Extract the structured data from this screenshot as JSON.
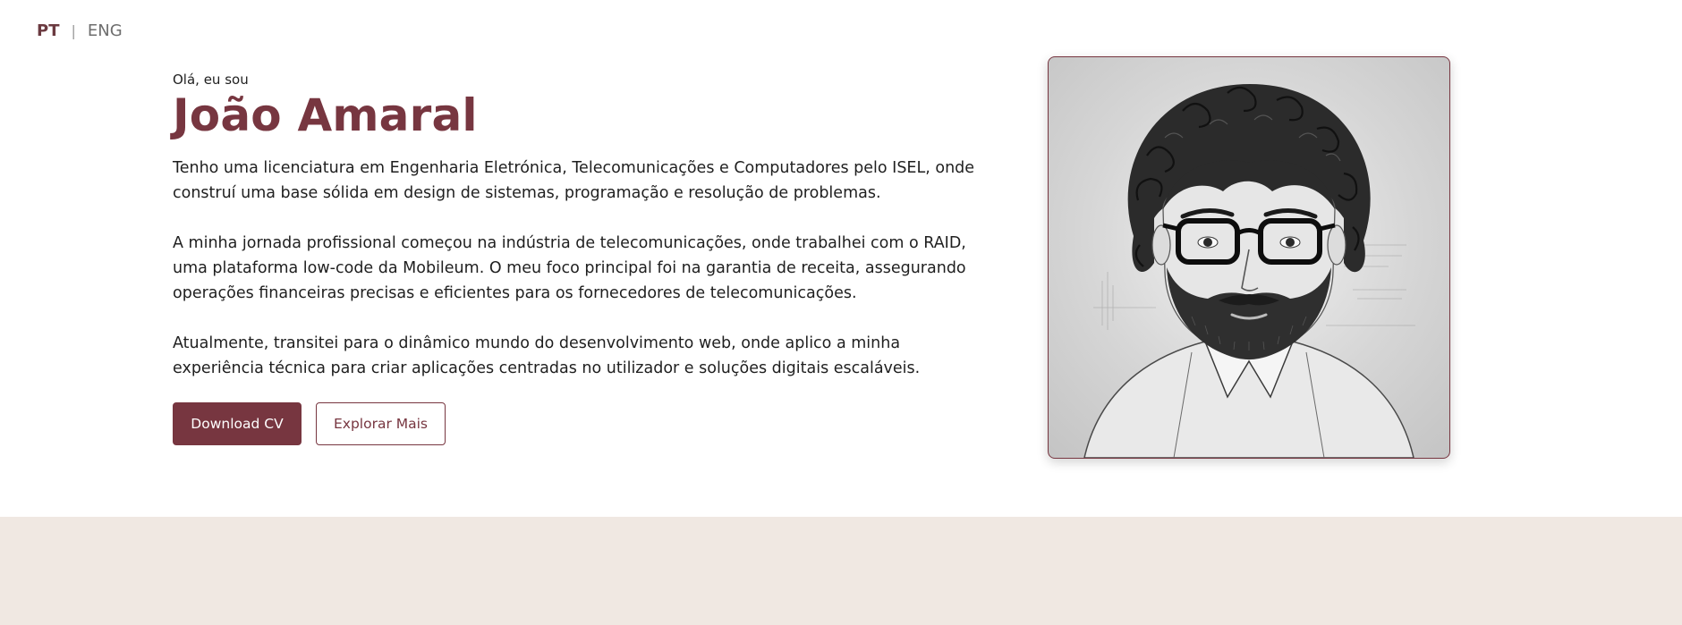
{
  "language": {
    "active": "PT",
    "separator": "|",
    "other": "ENG"
  },
  "hero": {
    "greeting": "Olá, eu sou",
    "name": "João Amaral",
    "paragraphs": [
      "Tenho uma licenciatura em Engenharia Eletrónica, Telecomunicações e Computadores pelo ISEL, onde construí uma base sólida em design de sistemas, programação e resolução de problemas.",
      "A minha jornada profissional começou na indústria de telecomunicações, onde trabalhei com o RAID, uma plataforma low-code da Mobileum. O meu foco principal foi na garantia de receita, assegurando operações financeiras precisas e eficientes para os fornecedores de telecomunicações.",
      "Atualmente, transitei para o dinâmico mundo do desenvolvimento web, onde aplico a minha experiência técnica para criar aplicações centradas no utilizador e soluções digitais escaláveis."
    ],
    "buttons": {
      "download": "Download CV",
      "explore": "Explorar Mais"
    }
  },
  "colors": {
    "accent": "#773640",
    "band": "#f0e8e2",
    "text": "#1f1f1f"
  }
}
